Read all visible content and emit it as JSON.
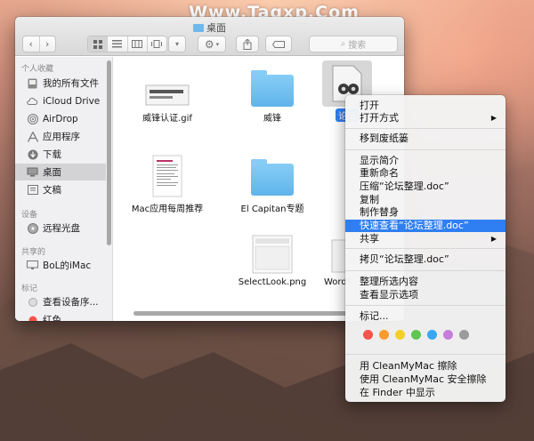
{
  "watermark": "Www.Tagxp.Com",
  "window": {
    "title": "桌面",
    "search_placeholder": "搜索"
  },
  "sidebar": {
    "sections": [
      {
        "title": "个人收藏",
        "items": [
          {
            "label": "我的所有文件",
            "icon": "all-files-icon"
          },
          {
            "label": "iCloud Drive",
            "icon": "cloud-icon"
          },
          {
            "label": "AirDrop",
            "icon": "airdrop-icon"
          },
          {
            "label": "应用程序",
            "icon": "applications-icon"
          },
          {
            "label": "下载",
            "icon": "download-icon"
          },
          {
            "label": "桌面",
            "icon": "desktop-icon",
            "selected": true
          },
          {
            "label": "文稿",
            "icon": "documents-icon"
          }
        ]
      },
      {
        "title": "设备",
        "items": [
          {
            "label": "远程光盘",
            "icon": "disc-icon"
          }
        ]
      },
      {
        "title": "共享的",
        "items": [
          {
            "label": "BoL的iMac",
            "icon": "imac-icon"
          }
        ]
      },
      {
        "title": "标记",
        "items": [
          {
            "label": "查看设备序...",
            "icon": "tag-icon"
          },
          {
            "label": "红色",
            "icon": "tag-icon"
          }
        ]
      }
    ]
  },
  "files": [
    {
      "name": "威锋认证.gif",
      "kind": "gif"
    },
    {
      "name": "威锋",
      "kind": "folder"
    },
    {
      "name": "论坛整理.doc",
      "kind": "doc",
      "truncated_label": "论坛"
    },
    {
      "name": "Mac应用每周推荐",
      "kind": "document"
    },
    {
      "name": "El Capitan专题",
      "kind": "folder"
    },
    {
      "name": "SelectLook.png",
      "kind": "png"
    },
    {
      "name": "WordS",
      "kind": "partial"
    }
  ],
  "context_menu": {
    "items": [
      "打开",
      "打开方式",
      "移到废纸篓",
      "显示简介",
      "重新命名",
      "压缩“论坛整理.doc”",
      "复制",
      "制作替身",
      "快速查看“论坛整理.doc”",
      "共享",
      "拷贝“论坛整理.doc”",
      "整理所选内容",
      "查看显示选项",
      "标记...",
      "用 CleanMyMac 擦除",
      "使用 CleanMyMac 安全擦除",
      "在 Finder 中显示"
    ],
    "tag_colors": [
      "#f5534b",
      "#f89b2e",
      "#f3cf2a",
      "#5ec653",
      "#3aa6f2",
      "#c77ddb",
      "#9b9b9b"
    ]
  }
}
